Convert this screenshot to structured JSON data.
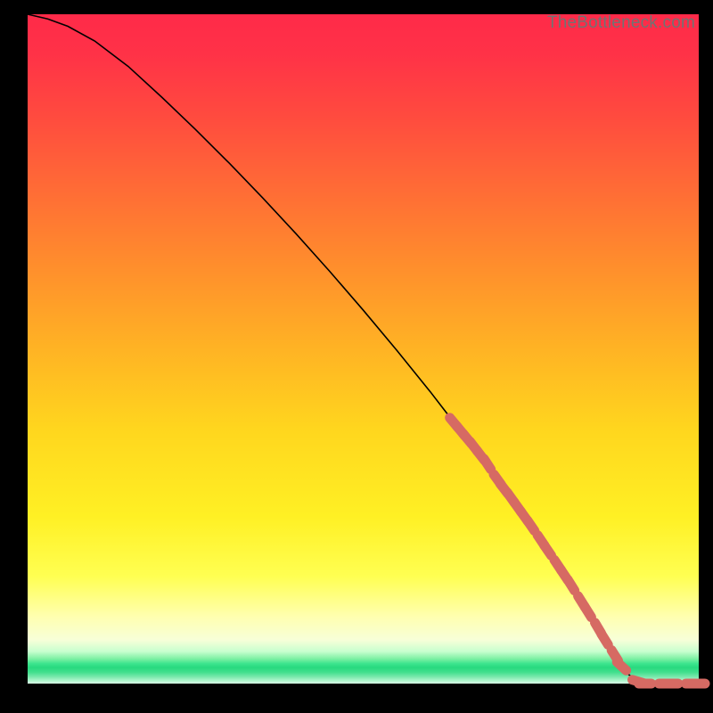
{
  "attribution": "TheBottleneck.com",
  "chart_data": {
    "type": "line",
    "title": "",
    "xlabel": "",
    "ylabel": "",
    "xlim": [
      0,
      100
    ],
    "ylim": [
      0,
      100
    ],
    "grid": false,
    "series": [
      {
        "name": "curve",
        "x": [
          0,
          3,
          6,
          10,
          15,
          20,
          25,
          30,
          35,
          40,
          45,
          50,
          55,
          60,
          62,
          64,
          66,
          68,
          70,
          72,
          74,
          76,
          78,
          80,
          82,
          84,
          86,
          88,
          89.5,
          91,
          92.5,
          94,
          96,
          98,
          100
        ],
        "y": [
          100,
          99.3,
          98.2,
          96.0,
          92.2,
          87.6,
          82.8,
          77.8,
          72.6,
          67.2,
          61.6,
          55.8,
          49.8,
          43.6,
          41.0,
          38.4,
          35.8,
          33.2,
          30.5,
          27.8,
          25.0,
          22.1,
          19.2,
          16.2,
          13.1,
          9.9,
          6.6,
          3.4,
          1.4,
          0.3,
          0.0,
          0.0,
          0.0,
          0.0,
          0.0
        ]
      }
    ],
    "markers": {
      "name": "highlighted-segment",
      "color": "#d66a63",
      "points": [
        {
          "x": 63.5,
          "y": 39.0
        },
        {
          "x": 64.5,
          "y": 37.8
        },
        {
          "x": 65.5,
          "y": 36.6
        },
        {
          "x": 66.5,
          "y": 35.4
        },
        {
          "x": 67.5,
          "y": 34.1
        },
        {
          "x": 68.5,
          "y": 32.8
        },
        {
          "x": 70.0,
          "y": 30.5
        },
        {
          "x": 71.0,
          "y": 29.1
        },
        {
          "x": 72.0,
          "y": 27.8
        },
        {
          "x": 73.0,
          "y": 26.4
        },
        {
          "x": 74.0,
          "y": 25.0
        },
        {
          "x": 75.0,
          "y": 23.6
        },
        {
          "x": 76.5,
          "y": 21.4
        },
        {
          "x": 77.5,
          "y": 19.9
        },
        {
          "x": 79.0,
          "y": 17.7
        },
        {
          "x": 80.0,
          "y": 16.2
        },
        {
          "x": 81.0,
          "y": 14.7
        },
        {
          "x": 82.5,
          "y": 12.3
        },
        {
          "x": 83.5,
          "y": 10.7
        },
        {
          "x": 85.0,
          "y": 8.3
        },
        {
          "x": 86.0,
          "y": 6.6
        },
        {
          "x": 87.5,
          "y": 4.2
        },
        {
          "x": 88.5,
          "y": 2.6
        },
        {
          "x": 91.0,
          "y": 0.3
        },
        {
          "x": 92.0,
          "y": 0.0
        },
        {
          "x": 95.0,
          "y": 0.0
        },
        {
          "x": 96.0,
          "y": 0.0
        },
        {
          "x": 99.0,
          "y": 0.0
        },
        {
          "x": 100.0,
          "y": 0.0
        }
      ]
    }
  }
}
